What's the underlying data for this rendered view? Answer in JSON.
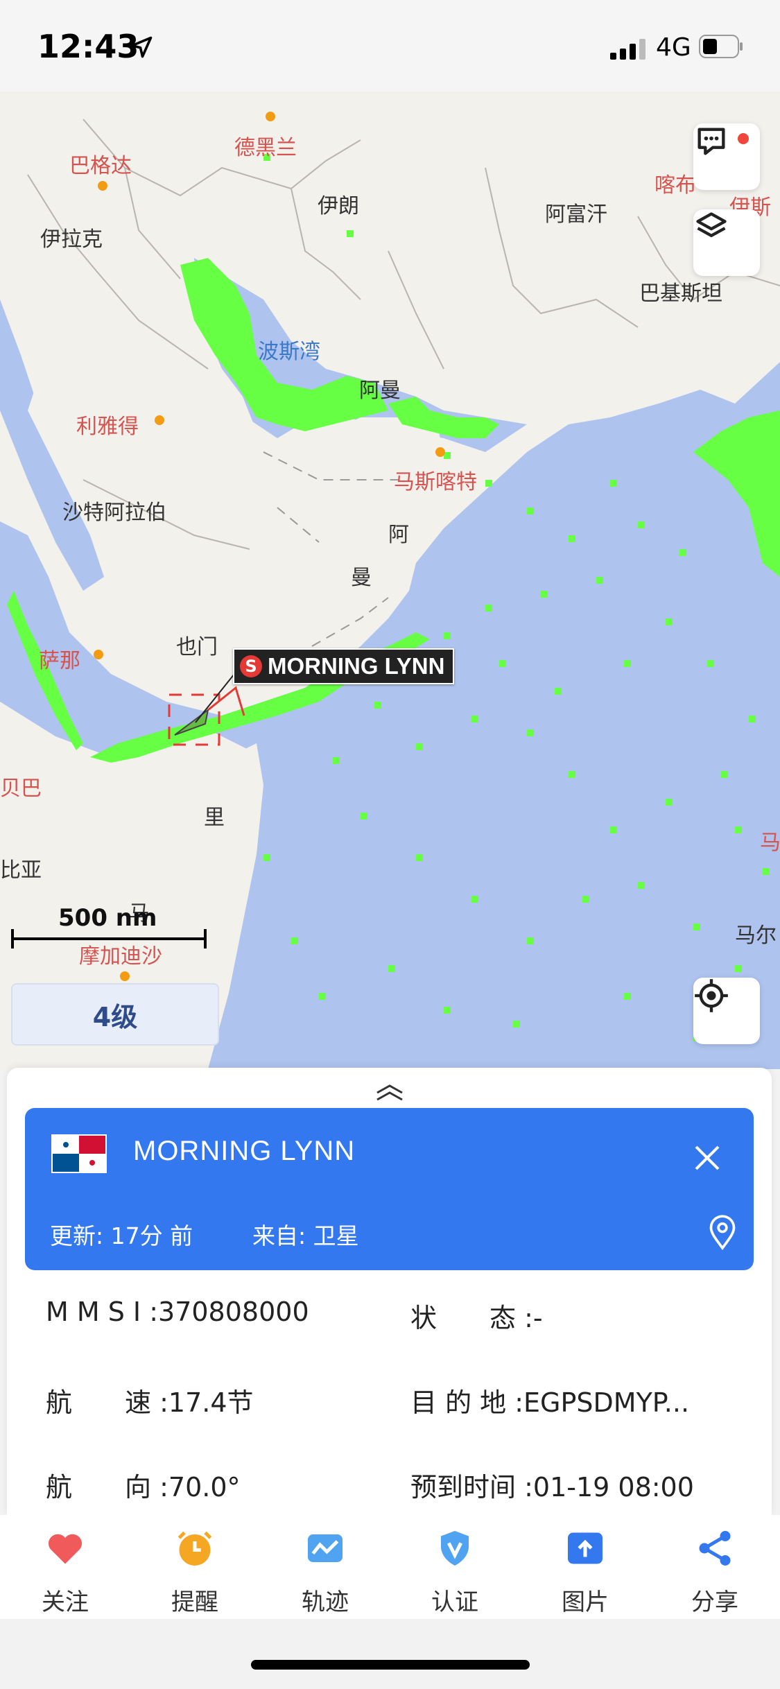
{
  "status_bar": {
    "time": "12:43",
    "network": "4G"
  },
  "map": {
    "labels": {
      "baghdad": "巴格达",
      "tehran": "德黑兰",
      "iran": "伊朗",
      "iraq": "伊拉克",
      "afghanistan": "阿富汗",
      "pakistan": "巴基斯坦",
      "kabul": "喀布",
      "islamabad": "伊斯",
      "persian_gulf": "波斯湾",
      "oman_top": "阿曼",
      "riyadh": "利雅得",
      "muscat": "马斯喀特",
      "saudi": "沙特阿拉伯",
      "oman_a": "阿",
      "oman_b": "曼",
      "yemen": "也门",
      "sanaa": "萨那",
      "djibouti": "贝巴",
      "somalia_li": "里",
      "somalia_ma": "马",
      "ethiopia": "比亚",
      "mogadishu": "摩加迪沙",
      "maldives": "马尔",
      "male": "马"
    },
    "ship_label": "MORNING LYNN",
    "ship_badge": "S",
    "scale": "500 nm",
    "zoom_level": "4级"
  },
  "ship": {
    "name": "MORNING LYNN",
    "update": "更新: 17分 前",
    "source": "来自: 卫星",
    "rows": [
      {
        "k1": "M M S I : ",
        "v1": "370808000",
        "k2": "状　　态 : ",
        "v2": "-"
      },
      {
        "k1": "航　　速 : ",
        "v1": "17.4节",
        "k2": "目 的 地 : ",
        "v2": "EGPSDMYP..."
      },
      {
        "k1": "航　　向 : ",
        "v1": "70.0°",
        "k2": "预到时间 : ",
        "v2": "01-19 08:00"
      }
    ]
  },
  "tabs": [
    {
      "label": "关注",
      "icon": "heart-icon",
      "color": "#f05a5a"
    },
    {
      "label": "提醒",
      "icon": "alarm-clock-icon",
      "color": "#f5a623"
    },
    {
      "label": "轨迹",
      "icon": "track-icon",
      "color": "#4fa3f0"
    },
    {
      "label": "认证",
      "icon": "verified-shield-icon",
      "color": "#4fa3f0"
    },
    {
      "label": "图片",
      "icon": "image-upload-icon",
      "color": "#3478f0"
    },
    {
      "label": "分享",
      "icon": "share-icon",
      "color": "#3478f0"
    }
  ],
  "colors": {
    "accent": "#3478f0",
    "sea": "#aec3ee",
    "land": "#f3f1ec",
    "ships": "#66ff44"
  }
}
